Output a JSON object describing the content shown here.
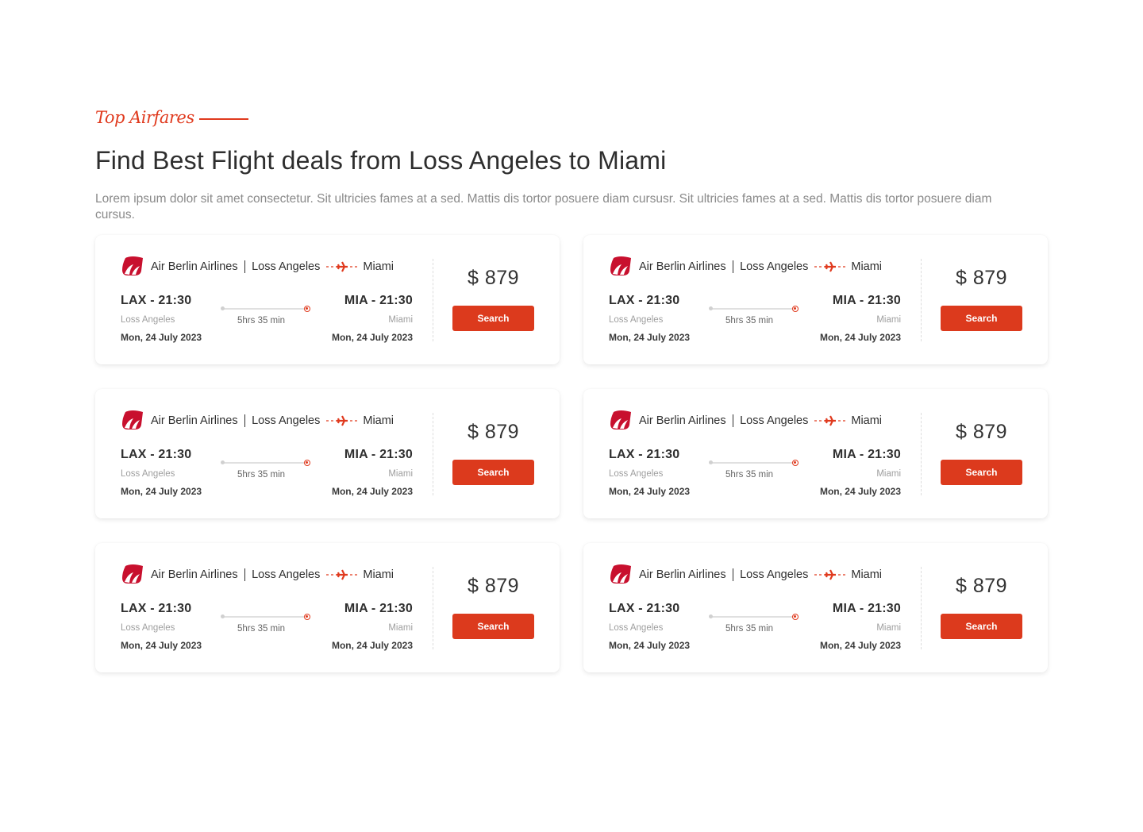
{
  "section": {
    "eyebrow": "Top Airfares",
    "heading": "Find Best Flight deals from Loss Angeles to Miami",
    "description": "Lorem ipsum dolor sit amet consectetur. Sit ultricies fames at a sed. Mattis dis tortor posuere diam cursusr. Sit ultricies fames at a sed. Mattis dis tortor posuere diam cursus."
  },
  "colors": {
    "accent": "#dc3a1d",
    "logo": "#c8102e"
  },
  "icons": {
    "airline_logo": "air-berlin-logo",
    "route": "airplane-icon"
  },
  "deals": [
    {
      "airline": "Air Berlin Airlines",
      "from_city": "Loss Angeles",
      "to_city": "Miami",
      "dep": "LAX - 21:30",
      "arr": "MIA - 21:30",
      "dep_city": "Loss Angeles",
      "arr_city": "Miami",
      "dep_date": "Mon, 24 July 2023",
      "arr_date": "Mon, 24 July 2023",
      "duration": "5hrs 35 min",
      "price": "$ 879",
      "button": "Search"
    },
    {
      "airline": "Air Berlin Airlines",
      "from_city": "Loss Angeles",
      "to_city": "Miami",
      "dep": "LAX - 21:30",
      "arr": "MIA - 21:30",
      "dep_city": "Loss Angeles",
      "arr_city": "Miami",
      "dep_date": "Mon, 24 July 2023",
      "arr_date": "Mon, 24 July 2023",
      "duration": "5hrs 35 min",
      "price": "$ 879",
      "button": "Search"
    },
    {
      "airline": "Air Berlin Airlines",
      "from_city": "Loss Angeles",
      "to_city": "Miami",
      "dep": "LAX - 21:30",
      "arr": "MIA - 21:30",
      "dep_city": "Loss Angeles",
      "arr_city": "Miami",
      "dep_date": "Mon, 24 July 2023",
      "arr_date": "Mon, 24 July 2023",
      "duration": "5hrs 35 min",
      "price": "$ 879",
      "button": "Search"
    },
    {
      "airline": "Air Berlin Airlines",
      "from_city": "Loss Angeles",
      "to_city": "Miami",
      "dep": "LAX - 21:30",
      "arr": "MIA - 21:30",
      "dep_city": "Loss Angeles",
      "arr_city": "Miami",
      "dep_date": "Mon, 24 July 2023",
      "arr_date": "Mon, 24 July 2023",
      "duration": "5hrs 35 min",
      "price": "$ 879",
      "button": "Search"
    },
    {
      "airline": "Air Berlin Airlines",
      "from_city": "Loss Angeles",
      "to_city": "Miami",
      "dep": "LAX - 21:30",
      "arr": "MIA - 21:30",
      "dep_city": "Loss Angeles",
      "arr_city": "Miami",
      "dep_date": "Mon, 24 July 2023",
      "arr_date": "Mon, 24 July 2023",
      "duration": "5hrs 35 min",
      "price": "$ 879",
      "button": "Search"
    },
    {
      "airline": "Air Berlin Airlines",
      "from_city": "Loss Angeles",
      "to_city": "Miami",
      "dep": "LAX - 21:30",
      "arr": "MIA - 21:30",
      "dep_city": "Loss Angeles",
      "arr_city": "Miami",
      "dep_date": "Mon, 24 July 2023",
      "arr_date": "Mon, 24 July 2023",
      "duration": "5hrs 35 min",
      "price": "$ 879",
      "button": "Search"
    }
  ]
}
